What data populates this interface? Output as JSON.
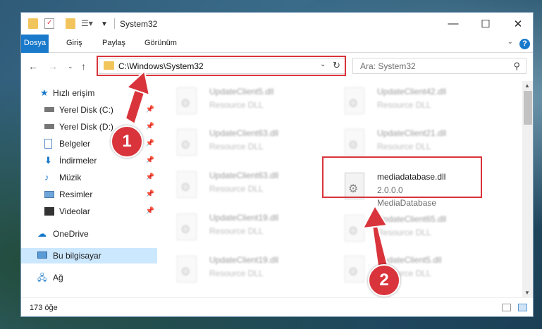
{
  "window": {
    "title": "System32",
    "controls": {
      "minimize": "—",
      "maximize": "☐",
      "close": "✕"
    }
  },
  "ribbon": {
    "tabs": [
      "Dosya",
      "Giriş",
      "Paylaş",
      "Görünüm"
    ],
    "help": "?"
  },
  "nav": {
    "address": "C:\\Windows\\System32",
    "search_placeholder": "Ara: System32"
  },
  "sidebar": {
    "items": [
      {
        "label": "Hızlı erişim",
        "icon": "star-icon"
      },
      {
        "label": "Yerel Disk (C:)",
        "icon": "drive-icon",
        "pinned": true
      },
      {
        "label": "Yerel Disk (D:)",
        "icon": "drive-icon",
        "pinned": true
      },
      {
        "label": "Belgeler",
        "icon": "documents-icon",
        "pinned": true
      },
      {
        "label": "İndirmeler",
        "icon": "download-icon",
        "pinned": true
      },
      {
        "label": "Müzik",
        "icon": "music-icon",
        "pinned": true
      },
      {
        "label": "Resimler",
        "icon": "pictures-icon",
        "pinned": true
      },
      {
        "label": "Videolar",
        "icon": "videos-icon",
        "pinned": true
      },
      {
        "label": "OneDrive",
        "icon": "cloud-icon"
      },
      {
        "label": "Bu bilgisayar",
        "icon": "computer-icon",
        "selected": true
      },
      {
        "label": "Ağ",
        "icon": "network-icon"
      }
    ]
  },
  "files": {
    "left": [
      {
        "name": "UpdateClient5.dll",
        "desc": "Resource DLL"
      },
      {
        "name": "UpdateClient63.dll",
        "desc": "Resource DLL"
      },
      {
        "name": "UpdateClient63.dll",
        "desc": "Resource DLL"
      },
      {
        "name": "UpdateClient19.dll",
        "desc": "Resource DLL"
      },
      {
        "name": "UpdateClient19.dll",
        "desc": "Resource DLL"
      }
    ],
    "right_top": [
      {
        "name": "UpdateClient42.dll",
        "desc": "Resource DLL"
      },
      {
        "name": "UpdateClient21.dll",
        "desc": "Resource DLL"
      }
    ],
    "highlighted": {
      "name": "mediadatabase.dll",
      "version": "2.0.0.0",
      "desc": "MediaDatabase"
    },
    "right_bottom": [
      {
        "name": "UpdateClient65.dll",
        "desc": "Resource DLL"
      },
      {
        "name": "UpdateClient5.dll",
        "desc": "Resource DLL"
      }
    ]
  },
  "status": {
    "item_count": "173 öğe"
  },
  "annotations": {
    "step1": "1",
    "step2": "2",
    "color": "#d9343b"
  }
}
